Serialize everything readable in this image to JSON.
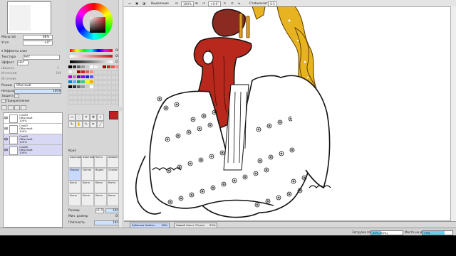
{
  "navigator": {
    "zoom_label": "Масштаб",
    "zoom_value": "88%",
    "angle_label": "Угол",
    "angle_value": "+0°"
  },
  "layers_panel": {
    "effects_title": "Эффекты слоя",
    "texture_label": "Текстура",
    "texture_value": "Нет",
    "effect_label": "Эффект",
    "effect_value": "Нет",
    "width_label": "Ширина",
    "width_value": "1",
    "intensity_label": "Интенсив.",
    "intensity_value": "100",
    "mode_label": "Режим",
    "mode_value": "Обычный",
    "opacity_label": "Непрозр.",
    "opacity_value": "100%",
    "protect_label": "Защита",
    "clip_label": "Прикрепление",
    "select_source_label": "Источник",
    "layers": [
      {
        "name": "Слой3",
        "mode": "Обычный",
        "opacity": "100%"
      },
      {
        "name": "Слой2",
        "mode": "Обычный",
        "opacity": "100%"
      },
      {
        "name": "Слой1",
        "mode": "Обычный",
        "opacity": "100%"
      },
      {
        "name": "Слой0",
        "mode": "Обычный",
        "opacity": "100%"
      }
    ]
  },
  "color_panel": {
    "h_value": "000",
    "s_value": "000",
    "v_value": "077",
    "colors": {
      "wheel_accent": "#c02020",
      "fg": "#c02020"
    }
  },
  "tools": {
    "brushes": [
      {
        "label": "Карандаш"
      },
      {
        "label": "Аэрограф"
      },
      {
        "label": "Кисть"
      },
      {
        "label": "Акварель"
      },
      {
        "label": "Маркер"
      },
      {
        "label": "Ластик"
      },
      {
        "label": "Выдел."
      },
      {
        "label": "Снятие"
      },
      {
        "label": "Кисть"
      },
      {
        "label": "Кисть"
      },
      {
        "label": "Кисть"
      },
      {
        "label": "Кисть"
      },
      {
        "label": "Кисть"
      },
      {
        "label": "Кисть"
      },
      {
        "label": "Кисть"
      },
      {
        "label": "Кисть"
      }
    ],
    "edge_label": "Края",
    "size_label": "Размер",
    "size_value": "100",
    "size_extra": "x1.0",
    "min_size_label": "Мин. размер",
    "min_size_value": "0%",
    "density_label": "Плотность",
    "density_value": "100",
    "texture_label": "Нормальн."
  },
  "canvas_toolbar": {
    "select_label": "Выделение",
    "zoom_value": "100%",
    "angle_value": "+0.0°",
    "stabilizer_label": "Стабилизатор",
    "stabilizer_value": "S-5"
  },
  "tabs": [
    {
      "label": "Рубашка Кайли...",
      "zoom": "58%"
    },
    {
      "label": "Новый Холст 23.psd",
      "zoom": "50%"
    }
  ],
  "status_bar": {
    "memory_label": "Загрузка памяти",
    "memory_value": "32% (30%)",
    "memory_fraction": 0.32,
    "disk_label": "Место на диске",
    "disk_value": "73%",
    "disk_fraction": 0.73
  }
}
